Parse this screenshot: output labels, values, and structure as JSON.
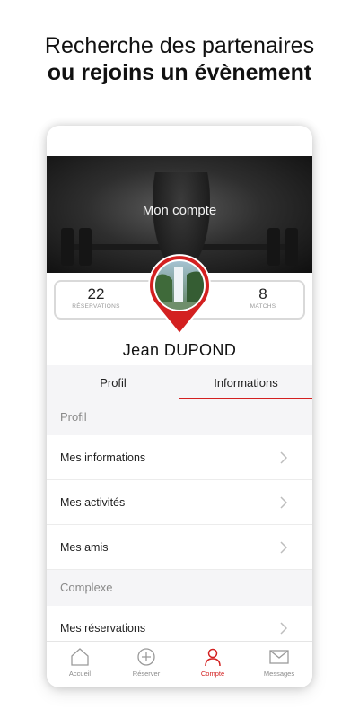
{
  "headline": {
    "line1": "Recherche des partenaires",
    "line2": "ou rejoins un évènement"
  },
  "screen": {
    "title": "Mon compte",
    "stats": {
      "reservations_value": "22",
      "reservations_label": "RÉSERVATIONS",
      "matches_value": "8",
      "matches_label": "MATCHS"
    },
    "user_name": "Jean  DUPOND",
    "tabs": [
      "Profil",
      "Informations"
    ],
    "active_tab": "Informations",
    "sections": [
      {
        "header": "Profil",
        "items": [
          "Mes informations",
          "Mes activités",
          "Mes amis"
        ]
      },
      {
        "header": "Complexe",
        "items": [
          "Mes réservations"
        ]
      }
    ],
    "tabbar": [
      {
        "label": "Accueil",
        "icon": "home-icon"
      },
      {
        "label": "Réserver",
        "icon": "plus-circle-icon"
      },
      {
        "label": "Compte",
        "icon": "person-icon"
      },
      {
        "label": "Messages",
        "icon": "envelope-icon"
      }
    ],
    "active_tabbar": "Compte"
  },
  "colors": {
    "accent": "#d32020",
    "section_bg": "#f5f5f7",
    "muted_text": "#8a8a8a"
  }
}
